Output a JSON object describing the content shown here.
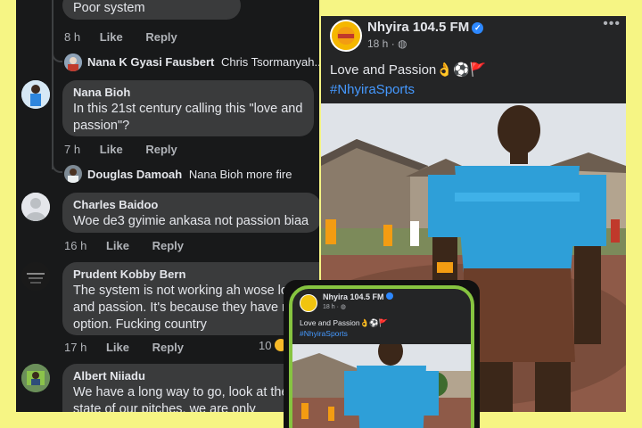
{
  "comments_panel": {
    "top_partial_text": "Poor system",
    "comment0": {
      "time": "8 h",
      "like": "Like",
      "reply": "Reply"
    },
    "reply1": {
      "author": "Nana K Gyasi Fausbert",
      "text": "Chris Tsormanyah..."
    },
    "comment1": {
      "author": "Nana Bioh",
      "text": "In this 21st century calling this \"love and passion\"?",
      "time": "7 h",
      "like": "Like",
      "reply": "Reply"
    },
    "reply2": {
      "author": "Douglas Damoah",
      "text": "Nana Bioh more fire"
    },
    "comment2": {
      "author": "Charles Baidoo",
      "text": "Woe de3 gyimie ankasa not passion biaa",
      "time": "16 h",
      "like": "Like",
      "reply": "Reply"
    },
    "comment3": {
      "author": "Prudent Kobby Bern",
      "text": "The system is not working ah wose love and passion. It's because they have no option. Fucking country",
      "time": "17 h",
      "like": "Like",
      "reply": "Reply",
      "reaction_count": "10"
    },
    "comment4": {
      "author": "Albert Niiadu",
      "text": "We have a long way to go, look at the state of our pitches, we are only"
    }
  },
  "post": {
    "page_name": "Nhyira 104.5 FM",
    "verified_mark": "✓",
    "time": "18 h",
    "audience_icon": "globe-icon",
    "more": "•••",
    "text": "Love and Passion",
    "emoji": "👌⚽🚩",
    "hashtag": "#NhyiraSports"
  },
  "phone_inset": {
    "page_name": "Nhyira 104.5 FM",
    "time": "18 h ·",
    "text": "Love and Passion",
    "emoji": "👌⚽🚩",
    "hashtag": "#NhyiraSports"
  },
  "colors": {
    "background": "#f6f584",
    "panel": "#18191a",
    "bubble": "#3a3b3c",
    "link": "#4599ff",
    "referee_shirt": "#2e9fd8"
  }
}
